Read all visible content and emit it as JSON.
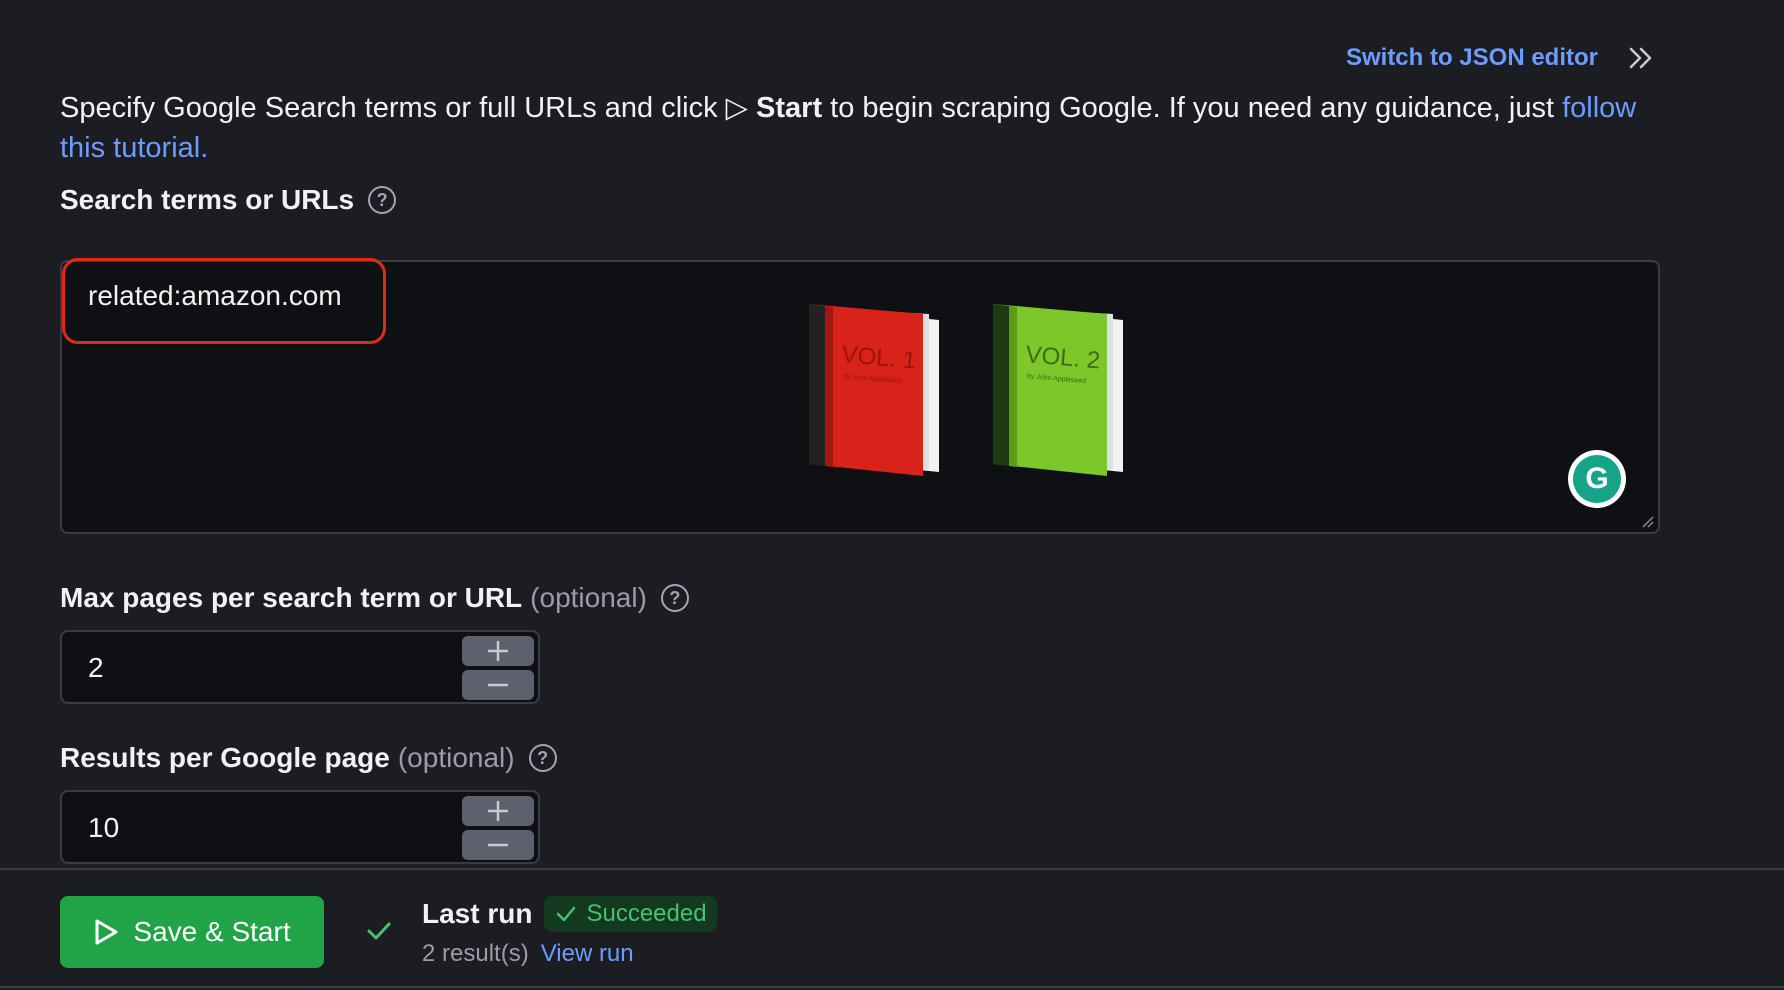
{
  "header": {
    "json_editor_link": "Switch to JSON editor",
    "expand_icon": "double-chevron-right-icon"
  },
  "intro": {
    "text_before": "Specify Google Search terms or full URLs and click ",
    "play_symbol": "▷",
    "bold": "Start",
    "text_after": " to begin scraping Google. If you need any guidance, just ",
    "link": "follow this tutorial."
  },
  "search_terms": {
    "label": "Search terms or URLs",
    "value": "related:amazon.com",
    "books": [
      "VOL. 1",
      "VOL. 2"
    ],
    "book_byline": "by John Appleseed"
  },
  "max_pages": {
    "label": "Max pages per search term or URL",
    "optional": "(optional)",
    "value": "2"
  },
  "results_per_page": {
    "label": "Results per Google page",
    "optional": "(optional)",
    "value": "10"
  },
  "footer": {
    "save_button": "Save & Start",
    "last_run_title": "Last run",
    "status": "Succeeded",
    "result_count": "2 result(s)",
    "view_run": "View run"
  },
  "colors": {
    "background": "#1c1d22",
    "accent_link": "#6b9cff",
    "primary_button": "#21a447",
    "success": "#46c26a",
    "highlight_box": "#e22a1c"
  }
}
